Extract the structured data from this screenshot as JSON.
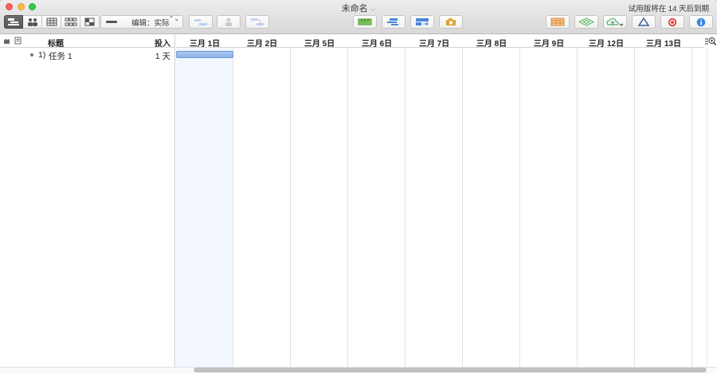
{
  "window": {
    "title": "未命名",
    "title_caret": "⌵",
    "trial_notice": "试用版将在 14 天后到期"
  },
  "toolbar": {
    "view_segments": [
      "gantt-view",
      "resources-view",
      "calendar-view",
      "network-view",
      "styles-view"
    ],
    "edit_mode_label": "编辑：实际",
    "edit_mode_arrows": "⌃⌄"
  },
  "table": {
    "columns": {
      "title": "标题",
      "effort": "投入"
    },
    "rows": [
      {
        "number": "1)",
        "name": "任务 1",
        "effort": "1 天"
      }
    ]
  },
  "gantt": {
    "days": [
      "三月 1日",
      "三月 2日",
      "三月 5日",
      "三月 6日",
      "三月 7日",
      "三月 8日",
      "三月 9日",
      "三月 12日",
      "三月 13日"
    ],
    "bar": {
      "task": "任务 1",
      "start_day": "三月 1日",
      "duration_days": 1
    },
    "zoom_glyph": "☰"
  },
  "colors": {
    "bar_fill": "#9cbcee",
    "highlight_column": "#f2f7ff"
  }
}
